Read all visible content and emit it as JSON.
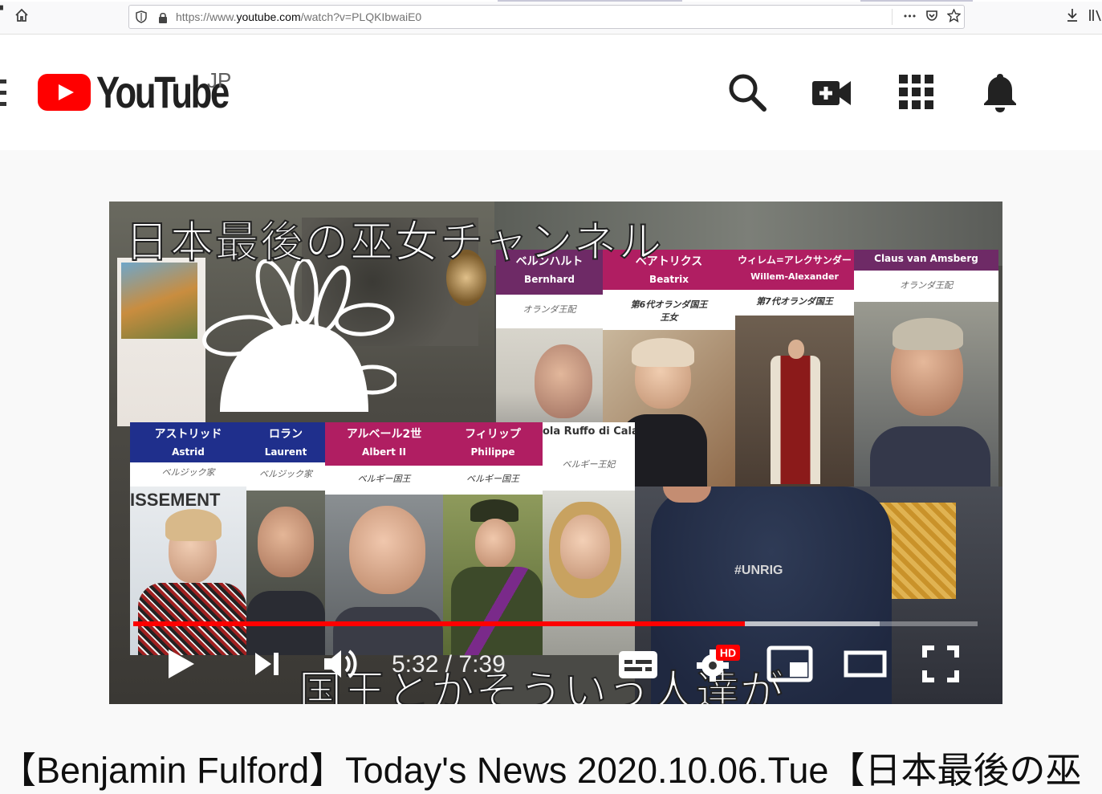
{
  "browser": {
    "url_prefix": "https://www.",
    "url_domain": "youtube.com",
    "url_path": "/watch?v=PLQKIbwaiE0",
    "more_glyph": "•••"
  },
  "youtube": {
    "logo_text": "YouTube",
    "region": "JP",
    "brand_color": "#ff0000"
  },
  "video": {
    "channel_title": "日本最後の巫女チャンネル",
    "bottom_caption": "国王とかそういう人達が",
    "cards_top": [
      {
        "jp": "ベルンハルト",
        "en": "Bernhard",
        "role": "オランダ王配"
      },
      {
        "jp": "ベアトリクス",
        "en": "Beatrix",
        "role": "第6代オランダ国王",
        "role2": "王女"
      },
      {
        "jp": "ウィレム=アレクサンダー",
        "en": "Willem-Alexander",
        "role": "第7代オランダ国王"
      },
      {
        "jp": "Claus van Amsberg",
        "en": "",
        "role": "オランダ王配"
      }
    ],
    "cards_bottom": [
      {
        "jp": "アストリッド",
        "en": "Astrid",
        "role": "ベルジック家"
      },
      {
        "jp": "ロラン",
        "en": "Laurent",
        "role": "ベルジック家"
      },
      {
        "jp": "アルベール2世",
        "en": "Albert II",
        "role": "ベルギー国王"
      },
      {
        "jp": "フィリップ",
        "en": "Philippe",
        "role": "ベルギー国王"
      },
      {
        "jp": "ola Ruffo di Calal",
        "en": "",
        "role": "ベルギー王妃"
      }
    ],
    "sign_text": "ISSEMENT",
    "shirt_text": "#UNRIG",
    "current_time": "5:32",
    "duration": "7:39",
    "time_display": "5:32 / 7:39",
    "played_fraction": 0.724,
    "buffered_fraction": 0.884,
    "hd_badge": "HD"
  },
  "title": "【Benjamin Fulford】Today's News 2020.10.06.Tue【日本最後の巫"
}
